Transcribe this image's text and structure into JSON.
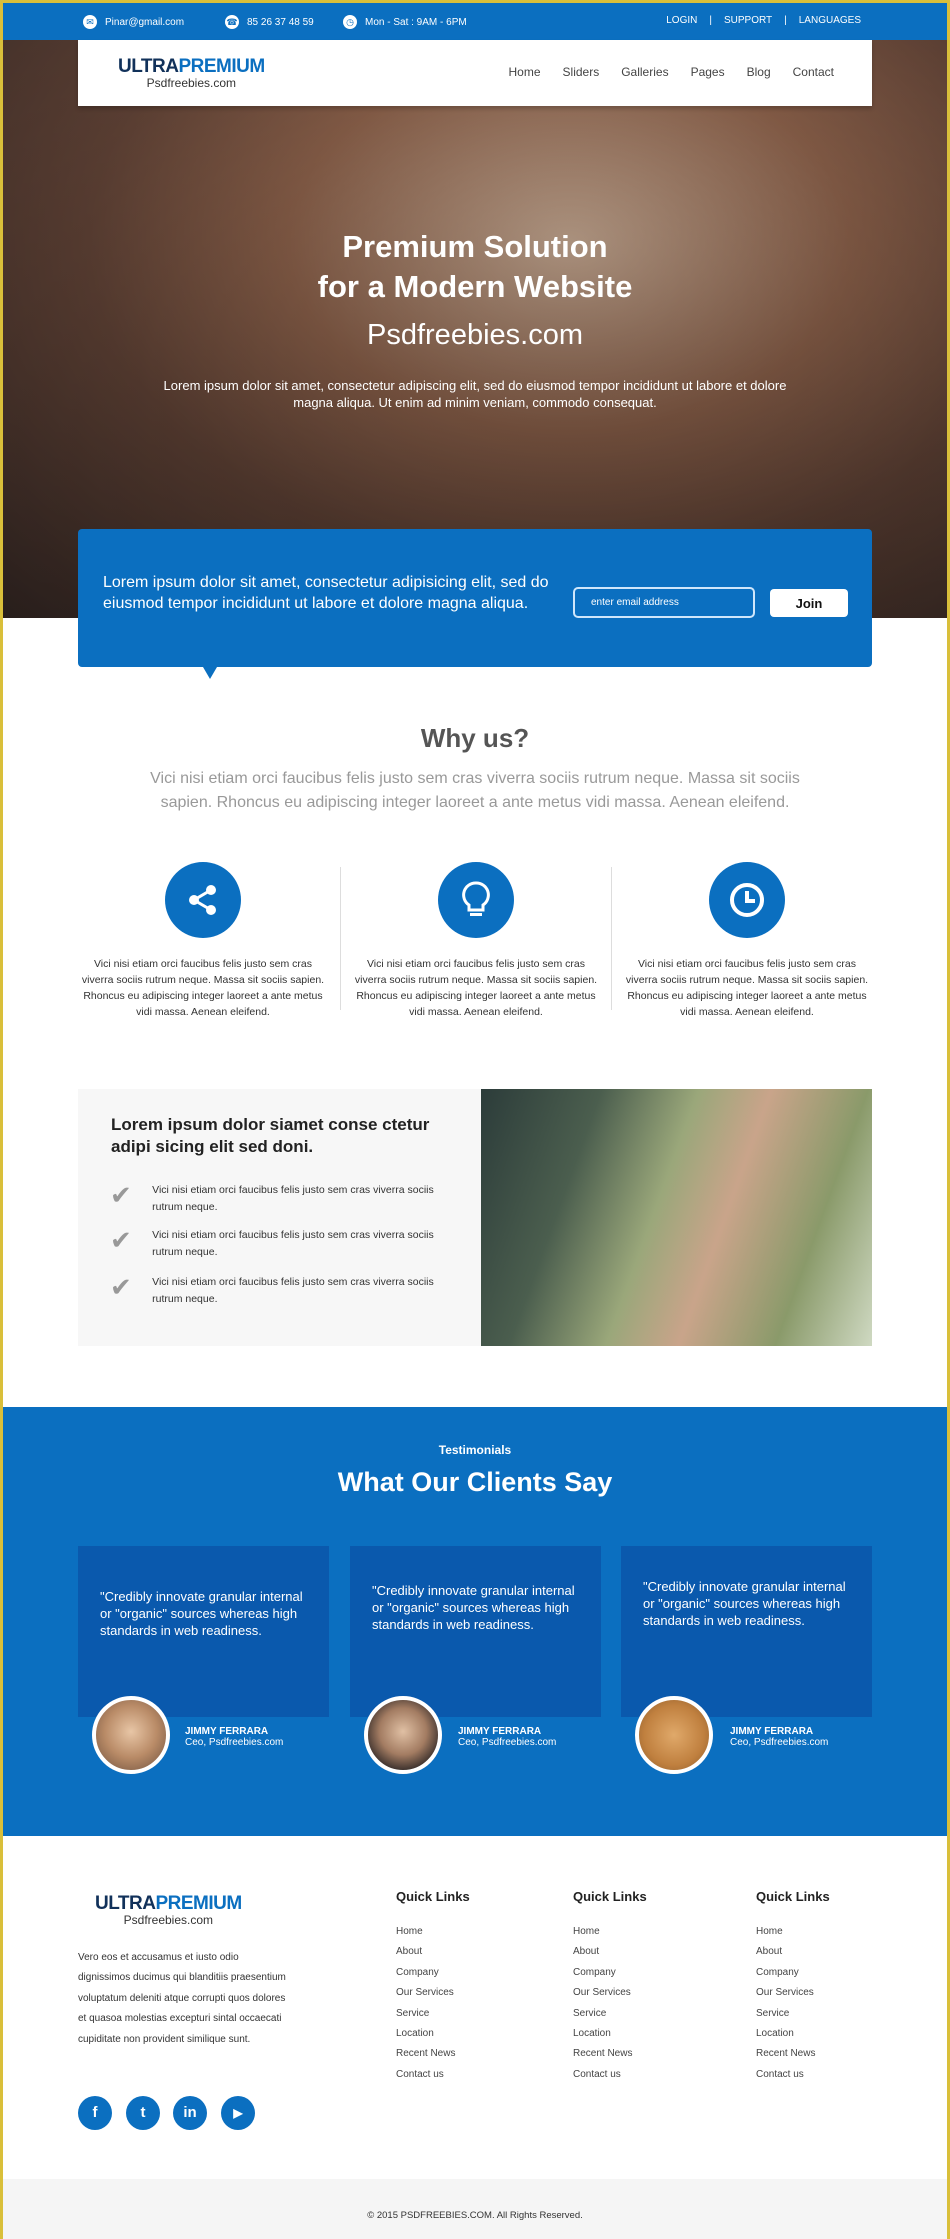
{
  "topbar": {
    "email": "Pinar@gmail.com",
    "phone": "85 26 37 48 59",
    "hours": "Mon - Sat : 9AM - 6PM",
    "links": [
      "LOGIN",
      "SUPPORT",
      "LANGUAGES"
    ],
    "sep": "|"
  },
  "logo": {
    "part1": "ULTRA",
    "part2": "PREMIUM",
    "sub": "Psdfreebies.com"
  },
  "nav": [
    "Home",
    "Sliders",
    "Galleries",
    "Pages",
    "Blog",
    "Contact"
  ],
  "hero": {
    "title1": "Premium Solution",
    "title2": "for a Modern Website",
    "site": "Psdfreebies.com",
    "text": "Lorem ipsum dolor sit amet, consectetur adipiscing elit, sed do eiusmod tempor incididunt ut labore et dolore magna aliqua. Ut enim ad minim veniam, commodo consequat."
  },
  "cta": {
    "text": "Lorem ipsum dolor sit amet, consectetur adipisicing elit, sed do eiusmod tempor incididunt ut labore et dolore magna aliqua.",
    "placeholder": "enter email address",
    "button": "Join"
  },
  "why": {
    "title": "Why us?",
    "text": "Vici nisi etiam orci faucibus felis justo sem cras viverra sociis rutrum neque. Massa sit sociis sapien. Rhoncus eu adipiscing integer laoreet a ante metus vidi massa. Aenean eleifend.",
    "features": [
      {
        "icon": "share-icon",
        "text": "Vici nisi etiam orci faucibus felis justo sem cras viverra sociis rutrum neque. Massa sit sociis sapien. Rhoncus eu adipiscing integer laoreet a ante metus vidi massa. Aenean eleifend."
      },
      {
        "icon": "lightbulb-icon",
        "text": "Vici nisi etiam orci faucibus felis justo sem cras viverra sociis rutrum neque. Massa sit sociis sapien. Rhoncus eu adipiscing integer laoreet a ante metus vidi massa. Aenean eleifend."
      },
      {
        "icon": "clock-icon",
        "text": "Vici nisi etiam orci faucibus felis justo sem cras viverra sociis rutrum neque. Massa sit sociis sapien. Rhoncus eu adipiscing integer laoreet a ante metus vidi massa. Aenean eleifend."
      }
    ]
  },
  "split": {
    "title": "Lorem ipsum dolor siamet conse ctetur adipi sicing elit sed doni.",
    "items": [
      "Vici nisi etiam orci faucibus felis justo sem cras viverra sociis rutrum neque.",
      "Vici nisi etiam orci faucibus felis justo sem cras viverra sociis rutrum neque.",
      "Vici nisi etiam orci faucibus felis justo sem cras viverra sociis rutrum neque."
    ]
  },
  "testimonials": {
    "label": "Testimonials",
    "title": "What Our Clients Say",
    "items": [
      {
        "quote": "\"Credibly innovate granular internal or \"organic\" sources whereas high standards in web readiness.",
        "name": "JIMMY FERRARA",
        "role": "Ceo, Psdfreebies.com"
      },
      {
        "quote": "\"Credibly innovate granular internal or \"organic\" sources whereas high standards in web readiness.",
        "name": "JIMMY FERRARA",
        "role": "Ceo, Psdfreebies.com"
      },
      {
        "quote": "\"Credibly innovate granular internal or \"organic\" sources whereas high standards in web readiness.",
        "name": "JIMMY FERRARA",
        "role": "Ceo, Psdfreebies.com"
      }
    ]
  },
  "footer": {
    "text": "Vero eos et accusamus et iusto odio dignissimos ducimus qui blanditiis praesentium voluptatum deleniti atque corrupti quos dolores et quasoa molestias excepturi sintal occaecati cupiditate non provident similique sunt.",
    "columns": [
      {
        "title": "Quick Links",
        "links": [
          "Home",
          "About",
          "Company",
          "Our Services",
          "Service",
          "Location",
          "Recent News",
          "Contact us"
        ]
      },
      {
        "title": "Quick Links",
        "links": [
          "Home",
          "About",
          "Company",
          "Our Services",
          "Service",
          "Location",
          "Recent News",
          "Contact us"
        ]
      },
      {
        "title": "Quick Links",
        "links": [
          "Home",
          "About",
          "Company",
          "Our Services",
          "Service",
          "Location",
          "Recent News",
          "Contact us"
        ]
      }
    ],
    "social": [
      {
        "icon": "facebook-icon",
        "glyph": "f"
      },
      {
        "icon": "twitter-icon",
        "glyph": "t"
      },
      {
        "icon": "linkedin-icon",
        "glyph": "in"
      },
      {
        "icon": "youtube-icon",
        "glyph": "▶"
      }
    ],
    "copyright": "© 2015 PSDFREEBIES.COM. All Rights Reserved."
  },
  "colors": {
    "brand": "#0b6fc0",
    "card": "#0a59ad",
    "logo_dark": "#11315a"
  }
}
